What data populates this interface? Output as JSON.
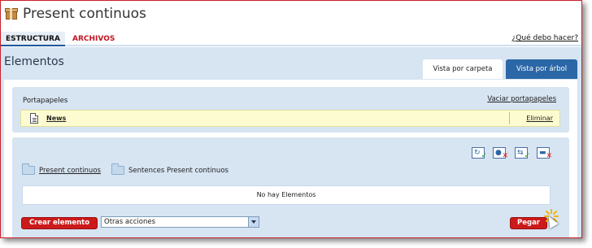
{
  "page": {
    "title": "Present continuos"
  },
  "nav": {
    "tabs": [
      {
        "label": "ESTRUCTURA",
        "active": true
      },
      {
        "label": "ARCHIVOS",
        "active": false
      }
    ],
    "help_link": "¿Qué debo hacer?"
  },
  "main": {
    "heading": "Elementos",
    "view_tabs": [
      {
        "label": "Vista por carpeta",
        "active": true
      },
      {
        "label": "Vista por árbol",
        "active": false
      }
    ]
  },
  "clipboard": {
    "title": "Portapapeles",
    "empty_link": "Vaciar portapapeles",
    "items": [
      {
        "label": "News",
        "action": "Eliminar",
        "icon": "document-icon"
      }
    ]
  },
  "elements": {
    "toolbar_icons": [
      "paste-ok-icon",
      "delete-icon",
      "move-ok-icon",
      "remove-icon"
    ],
    "folders": [
      {
        "label": "Present continuos",
        "link": true
      },
      {
        "label": "Sentences Present continuos",
        "link": false
      }
    ],
    "empty_message": "No hay Elementos",
    "create_button": "Crear elemento",
    "actions_select": {
      "value": "Otras acciones"
    },
    "paste_button": "Pegar"
  },
  "colors": {
    "accent_red": "#cc1a1a",
    "panel_blue": "#d7e4f2",
    "tab_blue": "#2b67a6",
    "clipboard_yellow": "#fdfcd0"
  }
}
